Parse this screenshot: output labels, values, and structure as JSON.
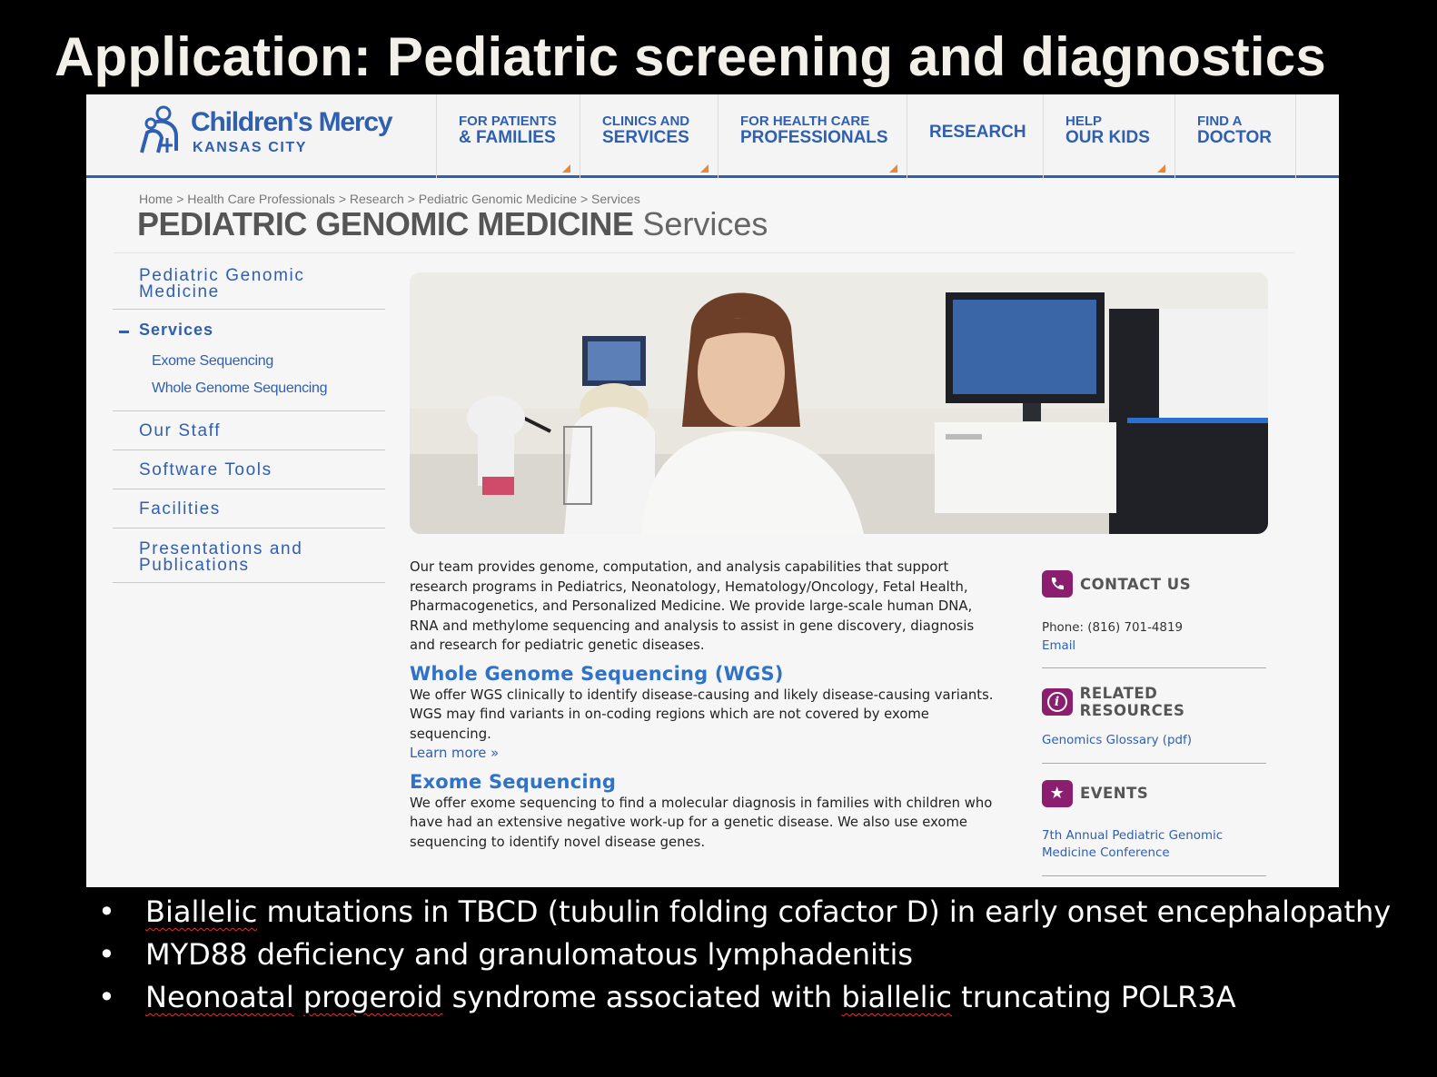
{
  "slide": {
    "title": "Application: Pediatric screening and diagnostics",
    "bullets": {
      "b1": {
        "word": "Biallelic",
        "rest": " mutations in TBCD (tubulin folding cofactor D) in early onset encephalopathy"
      },
      "b2": {
        "text": "MYD88 deficiency and granulomatous lymphadenitis"
      },
      "b3": {
        "w1": "Neonoatal",
        "sp1": " ",
        "w2": "progeroid",
        "mid": " syndrome associated with ",
        "w3": "biallelic",
        "rest": " truncating POLR3A"
      }
    }
  },
  "site": {
    "logo": {
      "name": "Children's Mercy",
      "sub": "KANSAS CITY"
    },
    "nav": [
      {
        "l1": "FOR PATIENTS",
        "l2": "& FAMILIES"
      },
      {
        "l1": "CLINICS AND",
        "l2": "SERVICES"
      },
      {
        "l1": "FOR HEALTH CARE",
        "l2": "PROFESSIONALS"
      },
      {
        "l2": "RESEARCH"
      },
      {
        "l1": "HELP",
        "l2": "OUR KIDS"
      },
      {
        "l1": "FIND A",
        "l2": "DOCTOR"
      }
    ],
    "breadcrumb": "Home > Health Care Professionals > Research > Pediatric Genomic Medicine > Services",
    "page_title": {
      "strong": "PEDIATRIC GENOMIC MEDICINE",
      "light": " Services"
    },
    "leftnav": {
      "pgm": "Pediatric Genomic Medicine",
      "services": "Services",
      "exome": "Exome Sequencing",
      "wgs": "Whole Genome Sequencing",
      "staff": "Our Staff",
      "software": "Software Tools",
      "facilities": "Facilities",
      "presentations": "Presentations and Publications"
    },
    "intro": "Our team provides genome, computation, and analysis capabilities that support research programs in Pediatrics, Neonatology, Hematology/Oncology, Fetal Health, Pharmacogenetics, and Personalized Medicine. We provide large-scale human DNA, RNA and methylome sequencing and analysis to assist in gene discovery, diagnosis and research for pediatric genetic diseases.",
    "wgs": {
      "heading": "Whole Genome Sequencing (WGS)",
      "text": "We offer WGS clinically to identify disease-causing and likely disease-causing variants. WGS may find variants in on-coding regions which are not covered by exome sequencing.",
      "learn_more": "Learn more »"
    },
    "exome": {
      "heading": "Exome Sequencing",
      "text": "We offer exome sequencing to find a molecular diagnosis in families with children who have had an extensive negative work-up for a genetic disease. We also use exome sequencing to identify novel disease genes."
    },
    "sidebar": {
      "contact": {
        "heading": "CONTACT US",
        "phone": "Phone: (816) 701-4819",
        "email": "Email"
      },
      "resources": {
        "heading": "RELATED RESOURCES",
        "link": "Genomics Glossary (pdf)"
      },
      "events": {
        "heading": "EVENTS",
        "link": "7th Annual Pediatric Genomic Medicine Conference"
      }
    },
    "colors": {
      "brand_blue": "#2f5fb0",
      "heading_blue": "#2f72c8",
      "accent_orange": "#e8893a",
      "sidebar_icon": "#8b1e6e"
    }
  }
}
